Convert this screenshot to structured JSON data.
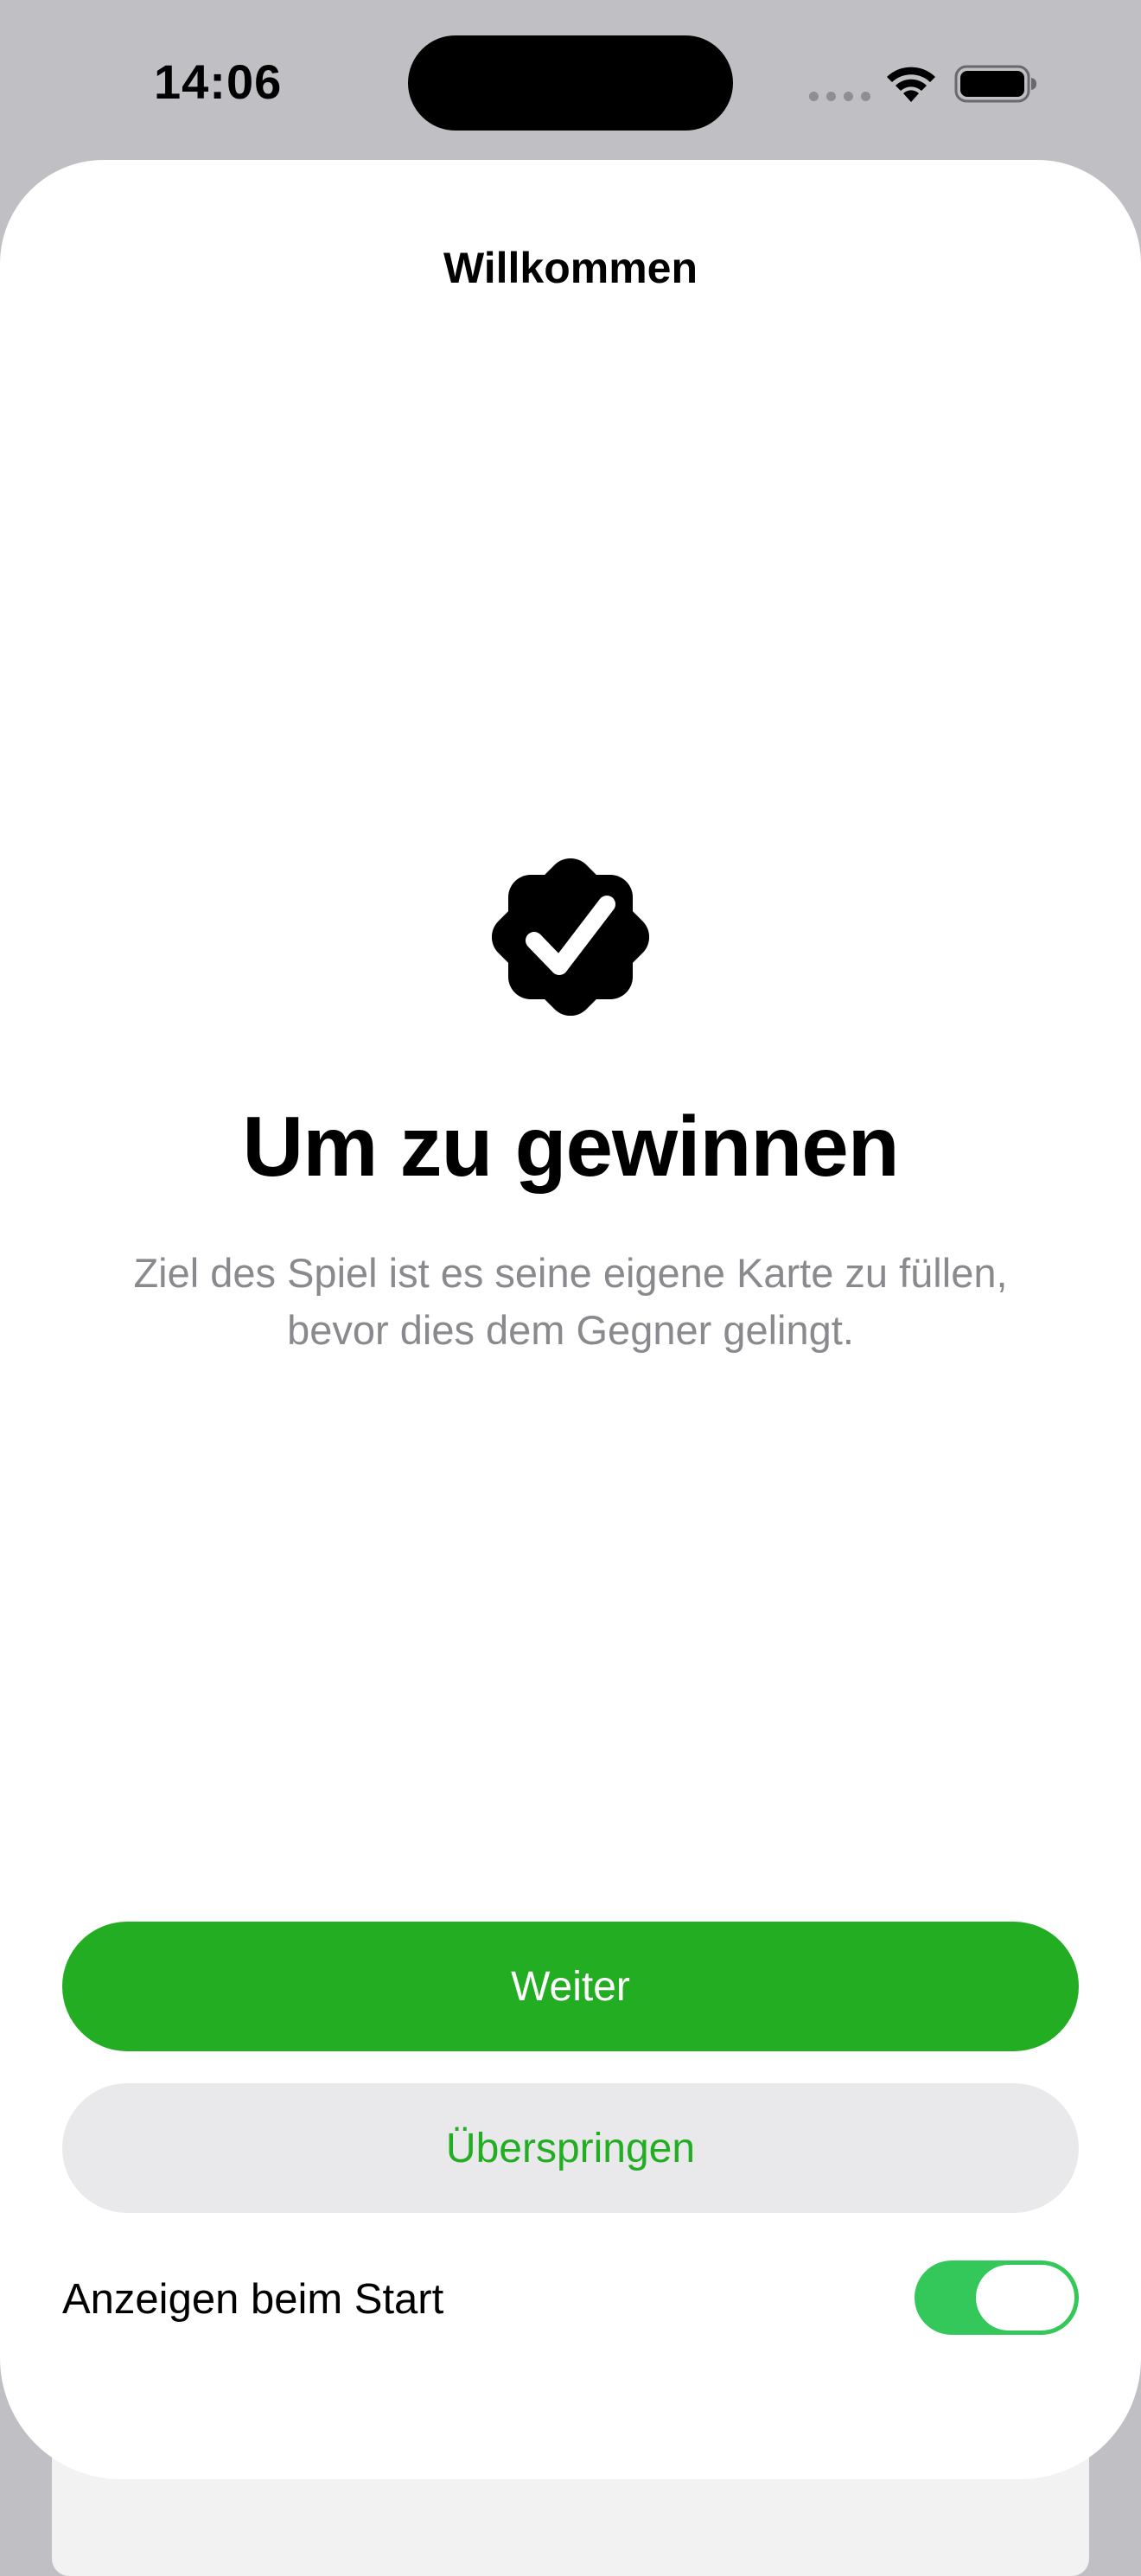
{
  "status_bar": {
    "time": "14:06"
  },
  "sheet": {
    "title": "Willkommen",
    "icon": "checkmark-seal-icon",
    "headline": "Um zu gewinnen",
    "description": "Ziel des Spiel ist es seine eigene Karte zu füllen, bevor dies dem Gegner gelingt.",
    "primary_button": "Weiter",
    "secondary_button": "Überspringen",
    "toggle": {
      "label": "Anzeigen beim Start",
      "on": true
    }
  },
  "colors": {
    "accent": "#22AD22",
    "toggle_on": "#34C759",
    "secondary_button_bg": "#E9E9EB",
    "description_text": "#8A8A8E"
  }
}
